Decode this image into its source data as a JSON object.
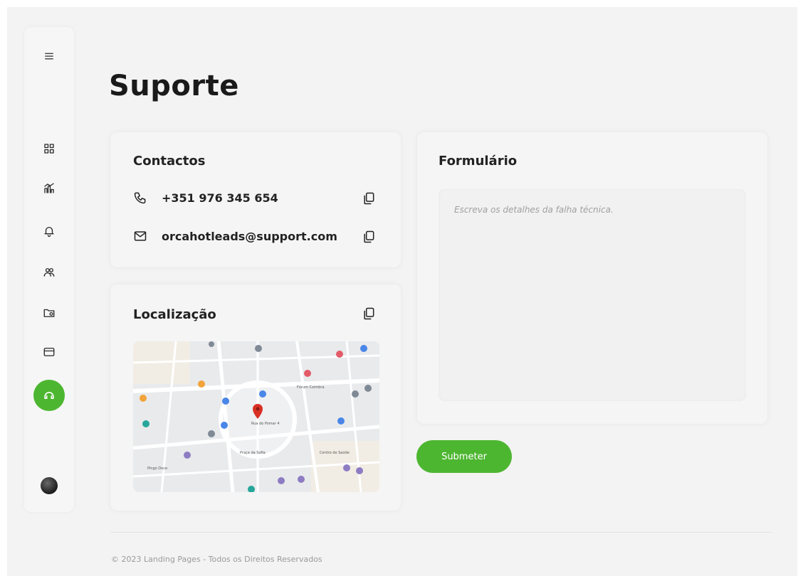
{
  "page": {
    "title": "Suporte"
  },
  "sidebar": {
    "items": [
      {
        "icon": "menu-icon"
      },
      {
        "icon": "dashboard-icon"
      },
      {
        "icon": "chart-icon"
      },
      {
        "icon": "bell-icon"
      },
      {
        "icon": "users-icon"
      },
      {
        "icon": "folder-settings-icon"
      },
      {
        "icon": "credit-card-icon"
      },
      {
        "icon": "support-icon",
        "active": true
      }
    ],
    "accent": "#4db630"
  },
  "contacts": {
    "title": "Contactos",
    "phone": "+351 976 345 654",
    "email": "orcahotleads@support.com"
  },
  "location": {
    "title": "Localização",
    "map_labels": [
      "Rua do Pomar 4",
      "Praça da Sofia",
      "Centro de Saúde",
      "Fórum Coimbra",
      "Pingo Doce"
    ]
  },
  "form": {
    "title": "Formulário",
    "placeholder": "Escreva os detalhes da falha técnica.",
    "value": "",
    "submit_label": "Submeter"
  },
  "footer": {
    "text": "© 2023 Landing Pages - Todos os Direitos Reservados"
  }
}
